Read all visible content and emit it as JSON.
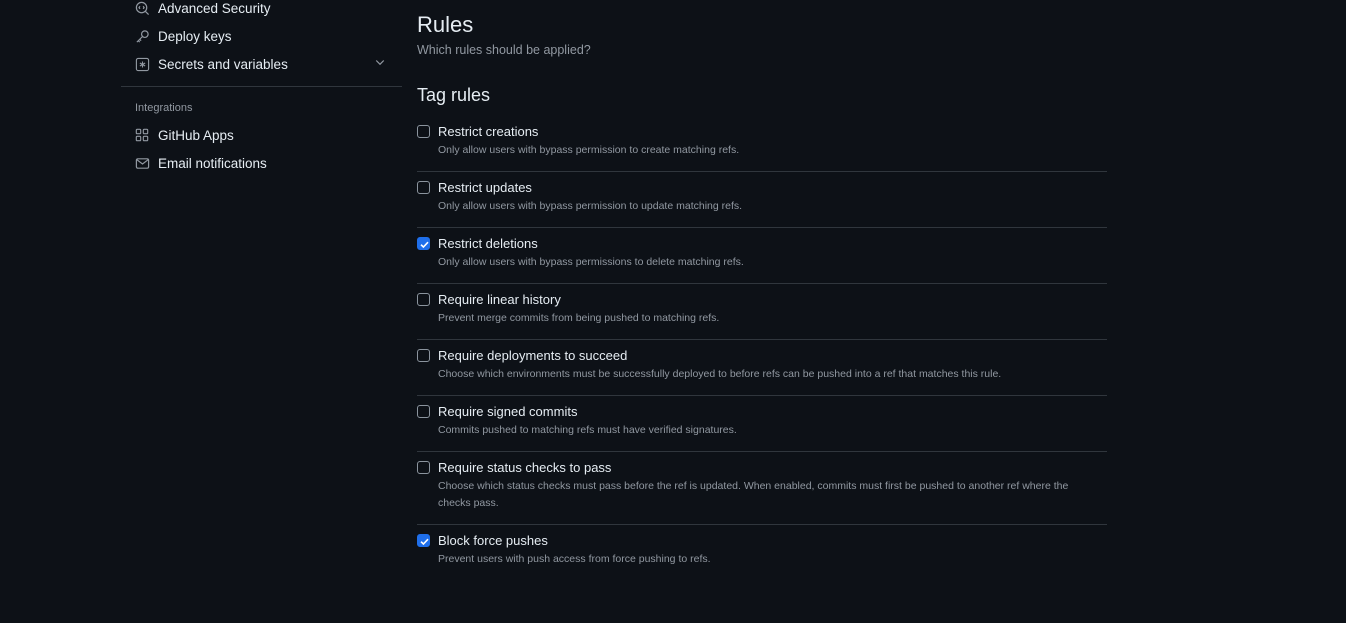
{
  "sidebar": {
    "items_top": [
      {
        "label": "Advanced Security",
        "icon": "shield-search-icon"
      },
      {
        "label": "Deploy keys",
        "icon": "key-icon"
      },
      {
        "label": "Secrets and variables",
        "icon": "asterisk-icon",
        "expandable": true
      }
    ],
    "integrations_heading": "Integrations",
    "items_integrations": [
      {
        "label": "GitHub Apps",
        "icon": "apps-icon"
      },
      {
        "label": "Email notifications",
        "icon": "mail-icon"
      }
    ]
  },
  "main": {
    "title": "Rules",
    "subtitle": "Which rules should be applied?",
    "section_title": "Tag rules",
    "rules": [
      {
        "label": "Restrict creations",
        "description": "Only allow users with bypass permission to create matching refs.",
        "checked": false
      },
      {
        "label": "Restrict updates",
        "description": "Only allow users with bypass permission to update matching refs.",
        "checked": false
      },
      {
        "label": "Restrict deletions",
        "description": "Only allow users with bypass permissions to delete matching refs.",
        "checked": true
      },
      {
        "label": "Require linear history",
        "description": "Prevent merge commits from being pushed to matching refs.",
        "checked": false
      },
      {
        "label": "Require deployments to succeed",
        "description": "Choose which environments must be successfully deployed to before refs can be pushed into a ref that matches this rule.",
        "checked": false
      },
      {
        "label": "Require signed commits",
        "description": "Commits pushed to matching refs must have verified signatures.",
        "checked": false
      },
      {
        "label": "Require status checks to pass",
        "description": "Choose which status checks must pass before the ref is updated. When enabled, commits must first be pushed to another ref where the checks pass.",
        "checked": false
      },
      {
        "label": "Block force pushes",
        "description": "Prevent users with push access from force pushing to refs.",
        "checked": true
      }
    ]
  },
  "colors": {
    "background": "#0d1117",
    "text": "#e6edf3",
    "muted": "#9198a1",
    "border": "#30363d",
    "accent": "#1f6feb"
  }
}
